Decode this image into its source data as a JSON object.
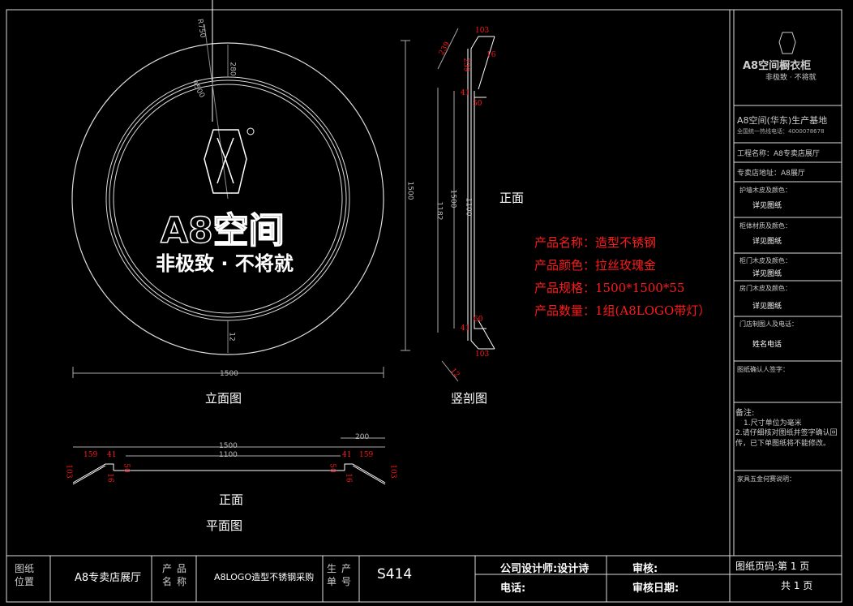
{
  "drawing": {
    "view_labels": {
      "elevation": "立面图",
      "section": "竖剖图",
      "front_right": "正面",
      "front_plan": "正面",
      "plan": "平面图"
    },
    "logo": {
      "brand": "A8空间",
      "slogan": "非极致 · 不将就"
    },
    "product": {
      "name_line": "产品名称：造型不锈钢",
      "color_line": "产品颜色：拉丝玫瑰金",
      "spec_line": "产品规格：1500*1500*55",
      "qty_line": "产品数量：1组(A8LOGO带灯）"
    },
    "dims": {
      "d1500_h": "1500",
      "d1500_v": "1500",
      "d1182": "1182",
      "d1500_inner": "1500",
      "d1100": "1100",
      "d103a": "103",
      "d103b": "103",
      "d239": "239",
      "d41a": "41",
      "d50a": "50",
      "d16": "16",
      "d60": "60",
      "d41b": "41",
      "d12": "12",
      "r500": "R500",
      "r750": "R750",
      "d280": "280",
      "d12b": "12",
      "p1500": "1500",
      "p1100": "1100",
      "p200": "200",
      "p159a": "159",
      "p159b": "159",
      "p41a": "41",
      "p41b": "41",
      "p103a": "103",
      "p103b": "103",
      "p50a": "50",
      "p50b": "50",
      "p16a": "16",
      "p16b": "16"
    }
  },
  "sidebar": {
    "brand": "A8空间橱衣柜",
    "slogan": "非极致 · 不将就",
    "base": "A8空间(华东)生产基地",
    "hotline": "全国统一热线电话：4000078678",
    "project_label": "工程名称：A8专卖店展厅",
    "address_label": "专卖店地址：A8展厅",
    "rows": [
      {
        "label": "护墙木皮及颜色：",
        "value": "详见图纸"
      },
      {
        "label": "柜体材质及颜色：",
        "value": "详见图纸"
      },
      {
        "label": "柜门木皮及颜色：",
        "value": "详见图纸"
      },
      {
        "label": "房门木皮及颜色：",
        "value": "详见图纸"
      },
      {
        "label": "门店制图人及电话：",
        "value": "姓名电话"
      }
    ],
    "confirm_label": "图纸确认人签字：",
    "notes_title": "备注:",
    "notes": [
      "1.尺寸单位为毫米",
      "2.请仔细核对图纸并签字确认回传，已下单图纸将不能修改。"
    ],
    "hardware_label": "家具五金何赛说明："
  },
  "titleblock": {
    "position_label": "图纸位置",
    "position_value": "A8专卖店展厅",
    "product_label": "产品名称",
    "product_value": "A8LOGO造型不锈钢采购",
    "order_label": "生产单号",
    "order_value": "S414",
    "designer": "公司设计师:设计诗",
    "phone": "电话:",
    "review": "审核:",
    "review_date": "审核日期:",
    "page": "图纸页码:第 1 页",
    "total": "共 1 页"
  }
}
